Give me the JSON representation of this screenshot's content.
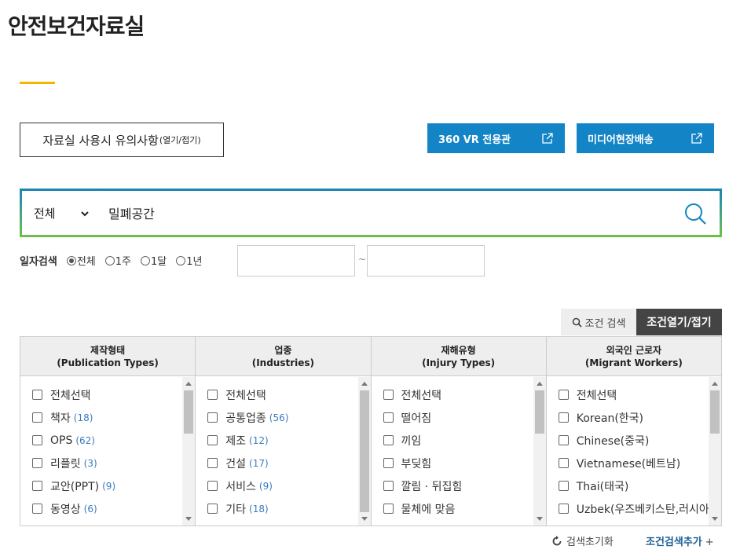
{
  "page": {
    "title": "안전보건자료실"
  },
  "actions": {
    "notice_label": "자료실 사용시 유의사항",
    "notice_small": "(열기/접기)",
    "vr_label": "360 VR 전용관",
    "media_label": "미디어현장배송"
  },
  "search": {
    "scope": "전체",
    "query": "밀폐공간"
  },
  "date": {
    "label": "일자검색",
    "options": [
      "전체",
      "1주",
      "1달",
      "1년"
    ],
    "selected": "전체",
    "separator": "~"
  },
  "condition": {
    "search_label": "조건 검색",
    "toggle_label": "조건열기/접기",
    "reset_label": "검색초기화",
    "add_label": "조건검색추가",
    "add_symbol": "+"
  },
  "filters": [
    {
      "title": "제작형태",
      "subtitle": "(Publication Types)",
      "items": [
        {
          "label": "전체선택",
          "count": ""
        },
        {
          "label": "책자",
          "count": "(18)"
        },
        {
          "label": "OPS",
          "count": "(62)"
        },
        {
          "label": "리플릿",
          "count": "(3)"
        },
        {
          "label": "교안(PPT)",
          "count": "(9)"
        },
        {
          "label": "동영상",
          "count": "(6)"
        }
      ]
    },
    {
      "title": "업종",
      "subtitle": "(Industries)",
      "items": [
        {
          "label": "전체선택",
          "count": ""
        },
        {
          "label": "공통업종",
          "count": "(56)"
        },
        {
          "label": "제조",
          "count": "(12)"
        },
        {
          "label": "건설",
          "count": "(17)"
        },
        {
          "label": "서비스",
          "count": "(9)"
        },
        {
          "label": "기타",
          "count": "(18)"
        }
      ]
    },
    {
      "title": "재해유형",
      "subtitle": "(Injury Types)",
      "items": [
        {
          "label": "전체선택",
          "count": ""
        },
        {
          "label": "떨어짐",
          "count": ""
        },
        {
          "label": "끼임",
          "count": ""
        },
        {
          "label": "부딪힘",
          "count": ""
        },
        {
          "label": "깔림 · 뒤집힘",
          "count": ""
        },
        {
          "label": "물체에 맞음",
          "count": ""
        }
      ]
    },
    {
      "title": "외국인 근로자",
      "subtitle": "(Migrant Workers)",
      "items": [
        {
          "label": "전체선택",
          "count": ""
        },
        {
          "label": "Korean(한국)",
          "count": ""
        },
        {
          "label": "Chinese(중국)",
          "count": ""
        },
        {
          "label": "Vietnamese(베트남)",
          "count": ""
        },
        {
          "label": "Thai(태국)",
          "count": ""
        },
        {
          "label": "Uzbek(우즈베키스탄,러시아)",
          "count": ""
        }
      ]
    }
  ]
}
